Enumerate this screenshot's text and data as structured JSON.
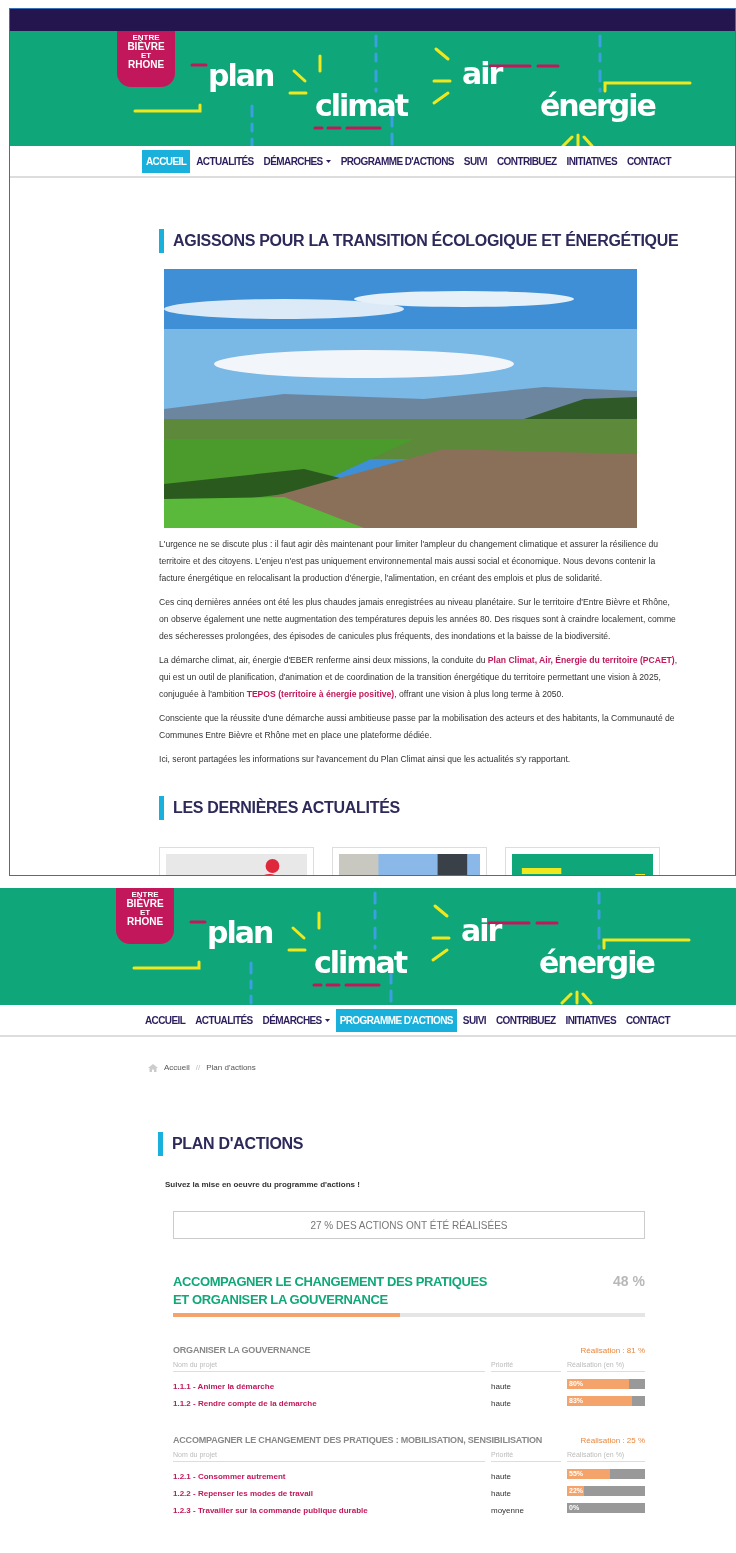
{
  "page_1": {
    "banner": {
      "logo": [
        "ENTRE",
        "BIÈVRE",
        "ET",
        "RHONE"
      ],
      "words": [
        "plan",
        "climat",
        "air",
        "énergie"
      ]
    },
    "nav": [
      {
        "label": "ACCUEIL",
        "selected": true,
        "dropdown": false
      },
      {
        "label": "ACTUALITÉS",
        "selected": false,
        "dropdown": false
      },
      {
        "label": "DÉMARCHES",
        "selected": false,
        "dropdown": true
      },
      {
        "label": "PROGRAMME D'ACTIONS",
        "selected": false,
        "dropdown": false
      },
      {
        "label": "SUIVI",
        "selected": false,
        "dropdown": false
      },
      {
        "label": "CONTRIBUEZ",
        "selected": false,
        "dropdown": false
      },
      {
        "label": "INITIATIVES",
        "selected": false,
        "dropdown": false
      },
      {
        "label": "CONTACT",
        "selected": false,
        "dropdown": false
      }
    ],
    "heading": "AGISSONS POUR LA TRANSITION ÉCOLOGIQUE ET ÉNERGÉTIQUE",
    "paragraphs": [
      [
        {
          "kind": "text",
          "text": "L'urgence ne se discute plus : il faut agir dès maintenant pour limiter l'ampleur du changement climatique et assurer la résilience du territoire et des citoyens. L'enjeu n'est pas uniquement environnemental mais aussi social et économique. Nous devons contenir la facture énergétique en relocalisant la production d'énergie, l'alimentation, en créant des emplois et plus de solidarité."
        }
      ],
      [
        {
          "kind": "text",
          "text": "Ces cinq dernières années ont été les plus chaudes jamais enregistrées au niveau planétaire. Sur le territoire d'Entre Bièvre et Rhône, on observe également une nette augmentation des températures depuis les années 80. Des risques sont à craindre localement, comme des sécheresses prolongées, des épisodes de canicules plus fréquents, des inondations et la baisse de la biodiversité."
        }
      ],
      [
        {
          "kind": "text",
          "text": "La démarche climat, air, énergie d'EBER renferme ainsi deux missions, la conduite du "
        },
        {
          "kind": "link",
          "text": "Plan Climat, Air, Énergie du territoire (PCAET)"
        },
        {
          "kind": "text",
          "text": ", qui est un outil de planification, d'animation et de coordination de la transition énergétique du territoire permettant une vision à 2025, conjuguée à l'ambition "
        },
        {
          "kind": "link",
          "text": "TEPOS (territoire à énergie positive)"
        },
        {
          "kind": "text",
          "text": ", offrant une vision à plus long terme à 2050."
        }
      ],
      [
        {
          "kind": "text",
          "text": "Consciente que la réussite d'une démarche aussi ambitieuse passe par la mobilisation des acteurs et des habitants, la Communauté de Communes Entre Bièvre et Rhône met en place une plateforme dédiée."
        }
      ],
      [
        {
          "kind": "text",
          "text": "Ici, seront partagées les informations sur l'avancement du Plan Climat ainsi que les actualités s'y rapportant."
        }
      ]
    ],
    "news_heading": "LES DERNIÈRES ACTUALITÉS",
    "news": [
      {
        "kind": "picture"
      },
      {
        "kind": "picture"
      },
      {
        "kind": "picture"
      }
    ]
  },
  "page_2": {
    "banner": {
      "logo": [
        "ENTRE",
        "BIÈVRE",
        "ET",
        "RHONE"
      ],
      "words": [
        "plan",
        "climat",
        "air",
        "énergie"
      ]
    },
    "nav": [
      {
        "label": "ACCUEIL",
        "selected": false,
        "dropdown": false
      },
      {
        "label": "ACTUALITÉS",
        "selected": false,
        "dropdown": false
      },
      {
        "label": "DÉMARCHES",
        "selected": false,
        "dropdown": true
      },
      {
        "label": "PROGRAMME D'ACTIONS",
        "selected": true,
        "dropdown": false
      },
      {
        "label": "SUIVI",
        "selected": false,
        "dropdown": false
      },
      {
        "label": "CONTRIBUEZ",
        "selected": false,
        "dropdown": false
      },
      {
        "label": "INITIATIVES",
        "selected": false,
        "dropdown": false
      },
      {
        "label": "CONTACT",
        "selected": false,
        "dropdown": false
      }
    ],
    "breadcrumb": [
      "Accueil",
      "//",
      "Plan d'actions"
    ],
    "heading": "PLAN D'ACTIONS",
    "subtitle": "Suivez la mise en oeuvre du programme d'actions !",
    "summary": "27 % DES ACTIONS ONT ÉTÉ RÉALISÉES",
    "axis": {
      "title": "ACCOMPAGNER LE CHANGEMENT DES PRATIQUES ET ORGANISER LA GOUVERNANCE",
      "percent": "48 %",
      "level": 0.48
    },
    "groups": [
      {
        "title": "ORGANISER LA GOUVERNANCE",
        "realisation": "Réalisation : 81 %",
        "columns": [
          "Nom du projet",
          "Priorité",
          "Réalisation (en %)"
        ],
        "rows": [
          {
            "name": "1.1.1 - Animer la démarche",
            "priority": "haute",
            "bar_label": "80%",
            "level": 0.8
          },
          {
            "name": "1.1.2 - Rendre compte de la démarche",
            "priority": "haute",
            "bar_label": "83%",
            "level": 0.83
          }
        ]
      },
      {
        "title": "ACCOMPAGNER LE CHANGEMENT DES PRATIQUES : MOBILISATION, SENSIBILISATION",
        "realisation": "Réalisation : 25 %",
        "columns": [
          "Nom du projet",
          "Priorité",
          "Réalisation (en %)"
        ],
        "rows": [
          {
            "name": "1.2.1 - Consommer autrement",
            "priority": "haute",
            "bar_label": "55%",
            "level": 0.55
          },
          {
            "name": "1.2.2 - Repenser les modes de travail",
            "priority": "haute",
            "bar_label": "22%",
            "level": 0.22
          },
          {
            "name": "1.2.3 - Travailler sur la commande publique durable",
            "priority": "moyenne",
            "bar_label": "0%",
            "level": 0
          }
        ]
      }
    ]
  }
}
